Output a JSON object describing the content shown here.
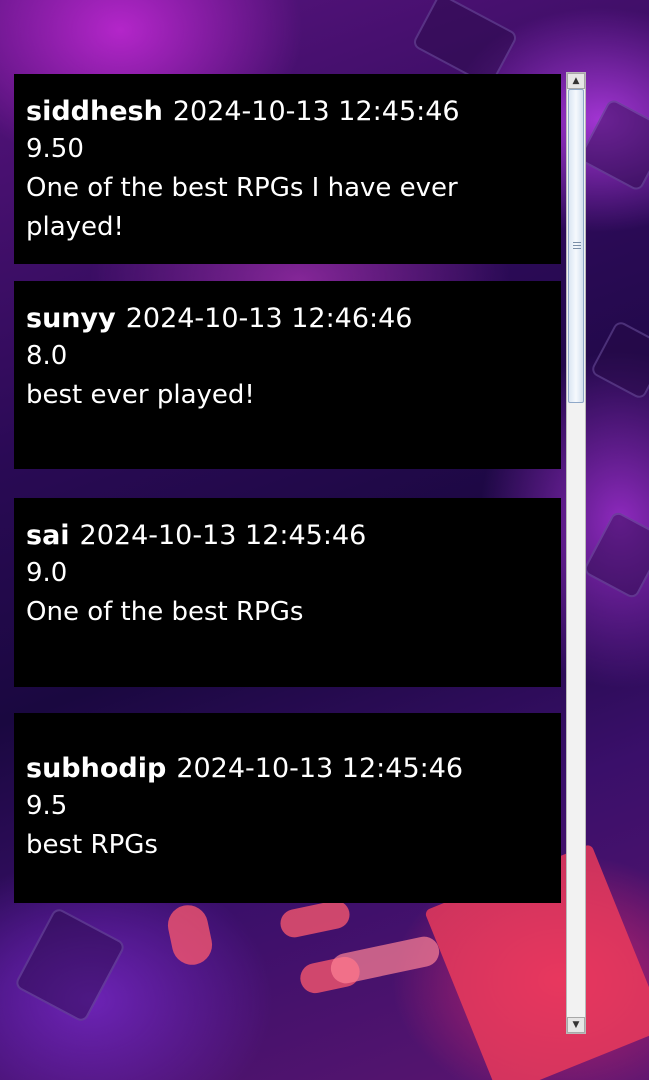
{
  "reviews": [
    {
      "username": "siddhesh",
      "timestamp": "2024-10-13 12:45:46",
      "rating": "9.50",
      "comment_line1": "One of the best RPGs I have ever",
      "comment_line2": "played!"
    },
    {
      "username": "sunyy",
      "timestamp": "2024-10-13 12:46:46",
      "rating": "8.0",
      "comment_line1": "best ever played!",
      "comment_line2": ""
    },
    {
      "username": "sai",
      "timestamp": "2024-10-13 12:45:46",
      "rating": "9.0",
      "comment_line1": "One of the best RPGs",
      "comment_line2": ""
    },
    {
      "username": "subhodip",
      "timestamp": "2024-10-13 12:45:46",
      "rating": "9.5",
      "comment_line1": "best RPGs",
      "comment_line2": ""
    }
  ],
  "scrollbar": {
    "up_glyph": "▲",
    "down_glyph": "▼",
    "scroll_position": 0,
    "visible_fraction": 0.33
  }
}
